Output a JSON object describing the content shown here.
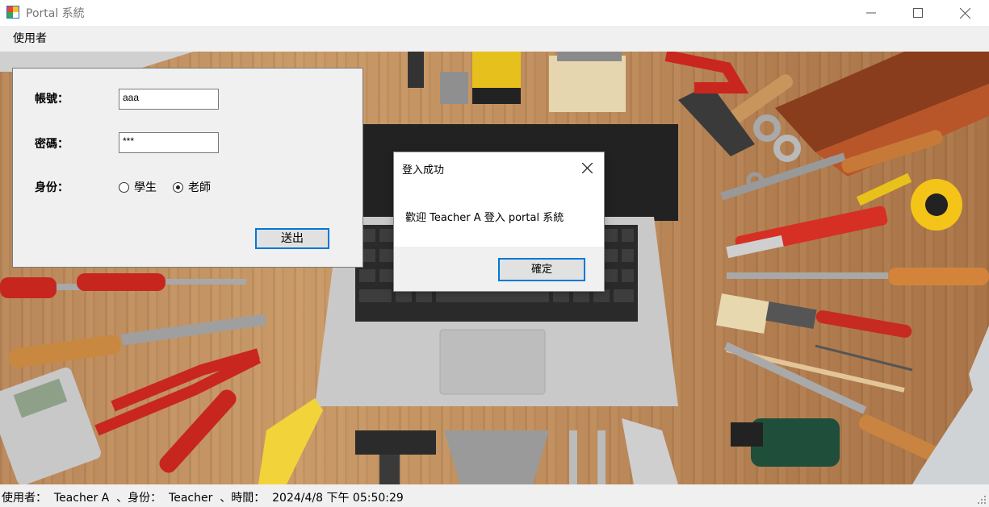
{
  "window": {
    "title": "Portal 系統"
  },
  "menu": {
    "items": [
      "使用者"
    ]
  },
  "login": {
    "account_label": "帳號：",
    "account_value": "aaa",
    "password_label": "密碼：",
    "password_value": "***",
    "role_label": "身份：",
    "role_options": [
      "學生",
      "老師"
    ],
    "selected_role": "老師",
    "submit_label": "送出"
  },
  "dialog": {
    "title": "登入成功",
    "message": "歡迎 Teacher A 登入 portal 系統",
    "ok_label": "確定"
  },
  "status": {
    "text": "使用者：  Teacher A  、身份：  Teacher  、時間：  2024/4/8 下午 05:50:29"
  },
  "colors": {
    "accent": "#0078d7",
    "panel": "#f0f0f0",
    "desk": "#c49260"
  }
}
